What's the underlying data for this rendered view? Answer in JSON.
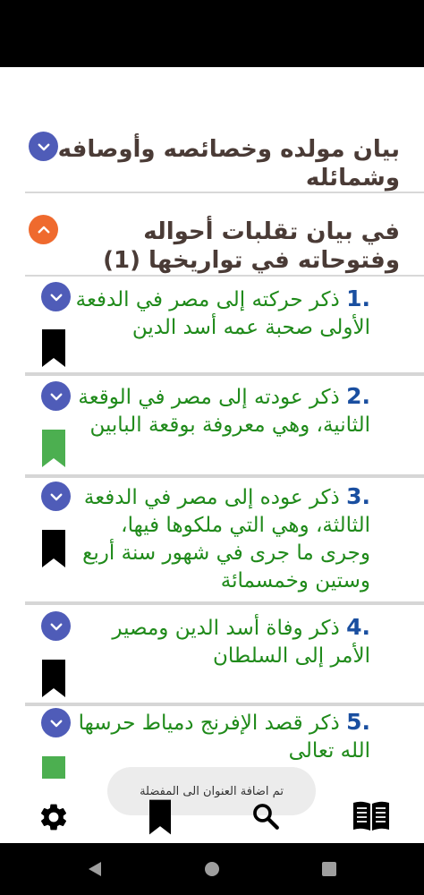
{
  "sections": [
    {
      "title": "بيان مولده وخصائصه وأوصافه وشمائله",
      "expanded": false
    },
    {
      "title": "في بيان تقلبات أحواله وفتوحاته في تواريخها (1)",
      "expanded": true
    }
  ],
  "chapters": [
    {
      "number": ".1",
      "title": "ذكر حركته إلى مصر في الدفعة الأولى صحبة عمه أسد الدين",
      "bookmarked": false
    },
    {
      "number": ".2",
      "title": "ذكر عودته إلى مصر في الوقعة الثانية، وهي معروفة بوقعة البابين",
      "bookmarked": true
    },
    {
      "number": ".3",
      "title": "ذكر عوده إلى مصر في الدفعة الثالثة، وهي التي ملكوها فيها، وجرى ما جرى في شهور سنة أربع وستين وخمسمائة",
      "bookmarked": false
    },
    {
      "number": ".4",
      "title": "ذكر وفاة أسد الدين ومصير الأمر إلى السلطان",
      "bookmarked": false
    },
    {
      "number": ".5",
      "title": "ذكر قصد الإفرنج دمياط حرسها الله تعالى",
      "bookmarked": true
    }
  ],
  "toast": {
    "message": "تم اضافة العنوان الى المفضلة"
  },
  "bottom_bar": {
    "icons": [
      "gear-icon",
      "bookmark-icon",
      "search-icon",
      "book-icon"
    ]
  },
  "colors": {
    "blue_button": "#4f5cb8",
    "orange_button": "#ef6a2e",
    "chapter_text": "#1f8a1a",
    "bookmark_active": "#4caf50",
    "bookmark_inactive": "#000000"
  }
}
